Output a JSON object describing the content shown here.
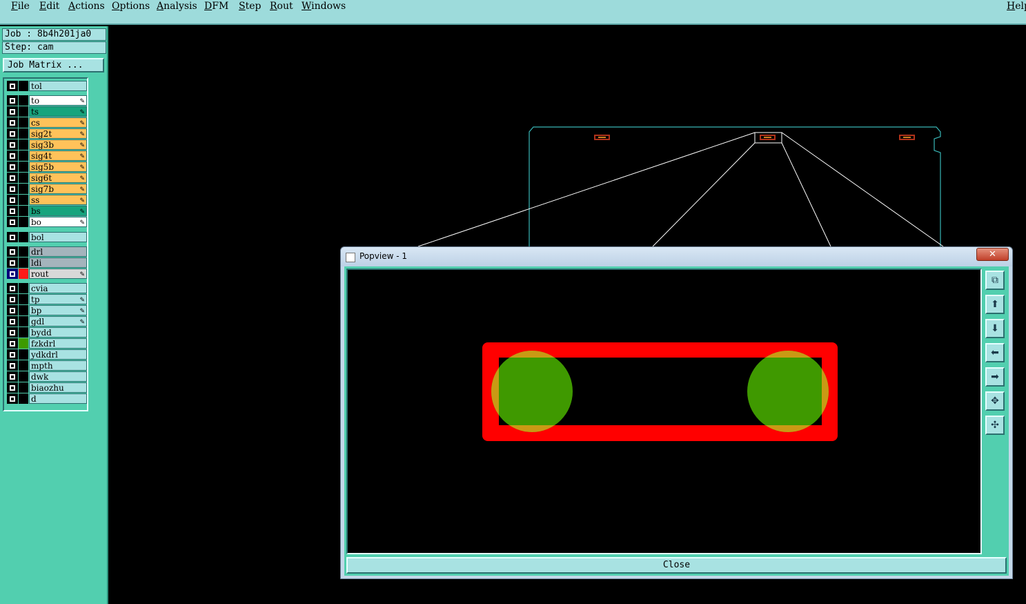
{
  "menu": {
    "file": "File",
    "edit": "Edit",
    "actions": "Actions",
    "options": "Options",
    "analysis": "Analysis",
    "dfm": "DFM",
    "step": "Step",
    "rout": "Rout",
    "windows": "Windows",
    "help": "Help"
  },
  "job": {
    "job_text": "Job : 8b4h201ja0",
    "step_text": "Step: cam",
    "matrix_button": "Job Matrix ..."
  },
  "layers": [
    {
      "name": "tol",
      "bg": "#a8e2e2",
      "edit": false,
      "color": "#000000"
    },
    {
      "name": "to",
      "bg": "#ffffff",
      "edit": true,
      "color": "#000000"
    },
    {
      "name": "ts",
      "bg": "#17a47d",
      "edit": true,
      "color": "#000000"
    },
    {
      "name": "cs",
      "bg": "#ffc25a",
      "edit": true,
      "color": "#000000"
    },
    {
      "name": "sig2t",
      "bg": "#ffc25a",
      "edit": true,
      "color": "#000000"
    },
    {
      "name": "sig3b",
      "bg": "#ffc25a",
      "edit": true,
      "color": "#000000"
    },
    {
      "name": "sig4t",
      "bg": "#ffc25a",
      "edit": true,
      "color": "#000000"
    },
    {
      "name": "sig5b",
      "bg": "#ffc25a",
      "edit": true,
      "color": "#000000"
    },
    {
      "name": "sig6t",
      "bg": "#ffc25a",
      "edit": true,
      "color": "#000000"
    },
    {
      "name": "sig7b",
      "bg": "#ffc25a",
      "edit": true,
      "color": "#000000"
    },
    {
      "name": "ss",
      "bg": "#ffc25a",
      "edit": true,
      "color": "#000000"
    },
    {
      "name": "bs",
      "bg": "#17a47d",
      "edit": true,
      "color": "#000000"
    },
    {
      "name": "bo",
      "bg": "#ffffff",
      "edit": true,
      "color": "#000000"
    },
    {
      "name": "bol",
      "bg": "#a8e2e2",
      "edit": false,
      "color": "#000000"
    },
    {
      "name": "drl",
      "bg": "#a4b4bc",
      "edit": false,
      "color": "#000000"
    },
    {
      "name": "ldi",
      "bg": "#a4b4bc",
      "edit": false,
      "color": "#000000"
    },
    {
      "name": "rout",
      "bg": "#d8d8d8",
      "edit": true,
      "color": "#ff1a1a",
      "active": true
    },
    {
      "name": "cvia",
      "bg": "#a8e2e2",
      "edit": false,
      "color": "#000000"
    },
    {
      "name": "tp",
      "bg": "#a8e2e2",
      "edit": true,
      "color": "#000000"
    },
    {
      "name": "bp",
      "bg": "#a8e2e2",
      "edit": true,
      "color": "#000000"
    },
    {
      "name": "gdl",
      "bg": "#a8e2e2",
      "edit": true,
      "color": "#000000"
    },
    {
      "name": "bydd",
      "bg": "#a8e2e2",
      "edit": false,
      "color": "#000000"
    },
    {
      "name": "fzkdrl",
      "bg": "#a8e2e2",
      "edit": false,
      "color": "#3d9a00"
    },
    {
      "name": "ydkdrl",
      "bg": "#a8e2e2",
      "edit": false,
      "color": "#000000"
    },
    {
      "name": "mpth",
      "bg": "#a8e2e2",
      "edit": false,
      "color": "#000000"
    },
    {
      "name": "dwk",
      "bg": "#a8e2e2",
      "edit": false,
      "color": "#000000"
    },
    {
      "name": "biaozhu",
      "bg": "#a8e2e2",
      "edit": false,
      "color": "#000000"
    },
    {
      "name": "d",
      "bg": "#a8e2e2",
      "edit": false,
      "color": "#000000"
    }
  ],
  "popview": {
    "title": "Popview - 1",
    "close_label": "Close",
    "tools": [
      "zoom-window-icon",
      "pan-up-icon",
      "pan-down-icon",
      "pan-left-icon",
      "pan-right-icon",
      "zoom-in-icon",
      "zoom-out-icon"
    ]
  },
  "colors": {
    "outline": "#39b7b7",
    "rout": "#ff0000",
    "drill": "#3f9900",
    "pad": "#b0321a"
  }
}
